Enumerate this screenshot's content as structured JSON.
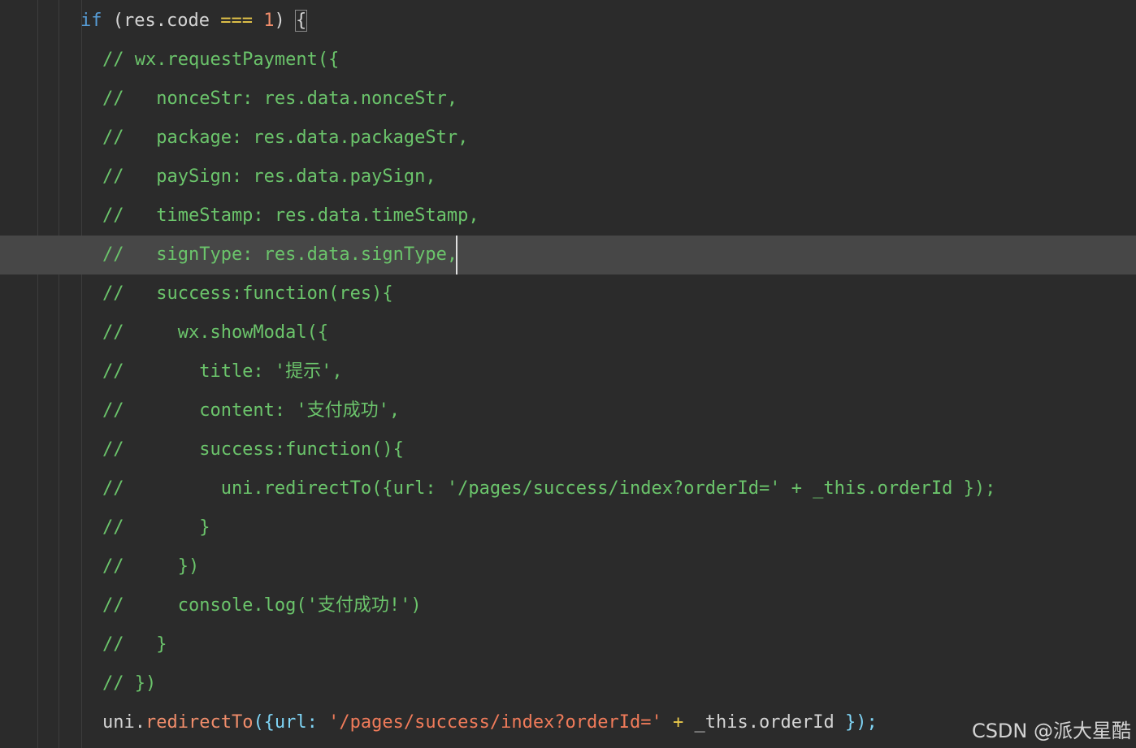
{
  "editor": {
    "line_if": {
      "kw": "if",
      "open": " (res.code ",
      "op": "===",
      "num": "1",
      "close": ") ",
      "brace": "{"
    },
    "comment_lines": [
      "// wx.requestPayment({",
      "//   nonceStr: res.data.nonceStr,",
      "//   package: res.data.packageStr,",
      "//   paySign: res.data.paySign,",
      "//   timeStamp: res.data.timeStamp,",
      "//   signType: res.data.signType,",
      "//   success:function(res){",
      "//     wx.showModal({",
      "//       title: '提示',",
      "//       content: '支付成功',",
      "//       success:function(){",
      "//         uni.redirectTo({url: '/pages/success/index?orderId=' + _this.orderId });",
      "//       }",
      "//     })",
      "//     console.log('支付成功!')",
      "//   }",
      "// })"
    ],
    "last_line": {
      "obj": "uni.",
      "fn": "redirectTo",
      "open": "({url: ",
      "str": "'/pages/success/index?orderId='",
      "plus": " + ",
      "tail": "_this.orderId ",
      "close": "});"
    }
  },
  "watermark": "CSDN @派大星酷",
  "colors": {
    "background": "#2b2b2b",
    "active_line": "#474747",
    "comment": "#6bc46b",
    "keyword": "#569cd6",
    "string": "#f07b5a",
    "function": "#f08d6b",
    "operator": "#e8c84a"
  }
}
